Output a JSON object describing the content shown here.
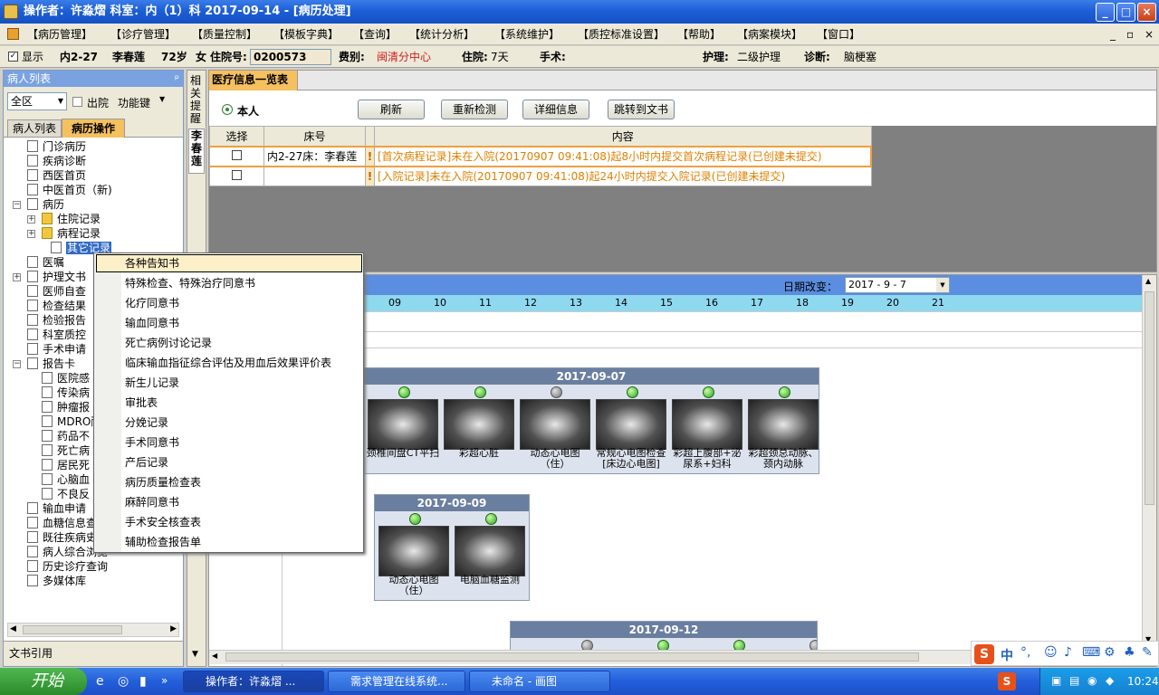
{
  "title": "操作者：许淼熠   科室：内（1）科   2017-09-14 - [病历处理]",
  "menu": [
    "【病历管理】",
    "【诊疗管理】",
    "【质量控制】",
    "【模板字典】",
    "【查询】",
    "【统计分析】",
    "【系统维护】",
    "【质控标准设置】",
    "【帮助】",
    "【病案模块】",
    "【窗口】"
  ],
  "info": {
    "show": "显示",
    "bed": "内2-27",
    "name": "李春莲",
    "age": "72岁",
    "sex": "女",
    "admit_label": "住院号:",
    "admit_no": "0200573",
    "fee_label": "费别:",
    "fee": "闽清分中心",
    "stay_label": "住院:",
    "stay": "7天",
    "op_label": "手术:",
    "nurse_label": "护理:",
    "nurse": "二级护理",
    "diag_label": "诊断:",
    "diag": "脑梗塞"
  },
  "left": {
    "header": "病人列表",
    "filter": "全区",
    "discharged": "出院",
    "funckey": "功能键",
    "tab1": "病人列表",
    "tab2": "病历操作",
    "footer": "文书引用"
  },
  "tree": [
    "门诊病历",
    "疾病诊断",
    "西医首页",
    "中医首页（新)",
    "病历",
    "住院记录",
    "病程记录",
    "其它记录",
    "医嘱",
    "护理文书",
    "医师自查",
    "检查结果",
    "检验报告",
    "科室质控",
    "手术申请",
    "报告卡",
    "医院感",
    "传染病",
    "肿瘤报",
    "MDRO耐",
    "药品不",
    "死亡病",
    "居民死",
    "心脑血",
    "不良反",
    "输血申请",
    "血糖信息查",
    "既往疾病史",
    "病人综合浏览",
    "历史诊疗查询",
    "多媒体库"
  ],
  "sidetabs": {
    "t1": "相关提醒",
    "t2": "李春莲"
  },
  "center": {
    "header": "医疗信息一览表",
    "radio": "本人",
    "buttons": [
      "刷新",
      "重新检测",
      "详细信息",
      "跳转到文书"
    ],
    "cols": [
      "选择",
      "床号",
      "内容"
    ],
    "rows": [
      {
        "bed": "内2-27床：李春莲",
        "content": "[首次病程记录]未在入院(20170907  09:41:08)起8小时内提交首次病程记录(已创建未提交)"
      },
      {
        "bed": "",
        "content": "[入院记录]未在入院(20170907  09:41:08)起24小时内提交入院记录(已创建未提交)"
      }
    ]
  },
  "timeline": {
    "date_label": "日期改变：",
    "date_value": "2017 - 9 - 7",
    "hours": [
      "09",
      "10",
      "11",
      "12",
      "13",
      "14",
      "15",
      "16",
      "17",
      "18",
      "19",
      "20",
      "21"
    ],
    "days": [
      {
        "date": "2017-09-07",
        "items": [
          "颈椎间盘CT平扫",
          "彩超心脏",
          "动态心电图（住）",
          "常规心电图检查[床边心电图]",
          "彩超上腹部+泌尿系+妇科",
          "彩超颈总动脉、颈内动脉"
        ]
      },
      {
        "date": "2017-09-09",
        "items": [
          "动态心电图（住）",
          "电脑血糖监测"
        ]
      },
      {
        "date": "2017-09-12",
        "items": []
      }
    ]
  },
  "popup": [
    "各种告知书",
    "特殊检查、特殊治疗同意书",
    "化疗同意书",
    "输血同意书",
    "死亡病例讨论记录",
    "临床输血指征综合评估及用血后效果评价表",
    "新生儿记录",
    "审批表",
    "分娩记录",
    "手术同意书",
    "产后记录",
    "病历质量检查表",
    "麻醉同意书",
    "手术安全核查表",
    "辅助检查报告单"
  ],
  "taskbar": {
    "start": "开始",
    "tasks": [
      "操作者：许淼熠 ...",
      "需求管理在线系统...",
      "未命名 - 画图"
    ],
    "clock": "10:24"
  },
  "ime": {
    "label": "中"
  }
}
